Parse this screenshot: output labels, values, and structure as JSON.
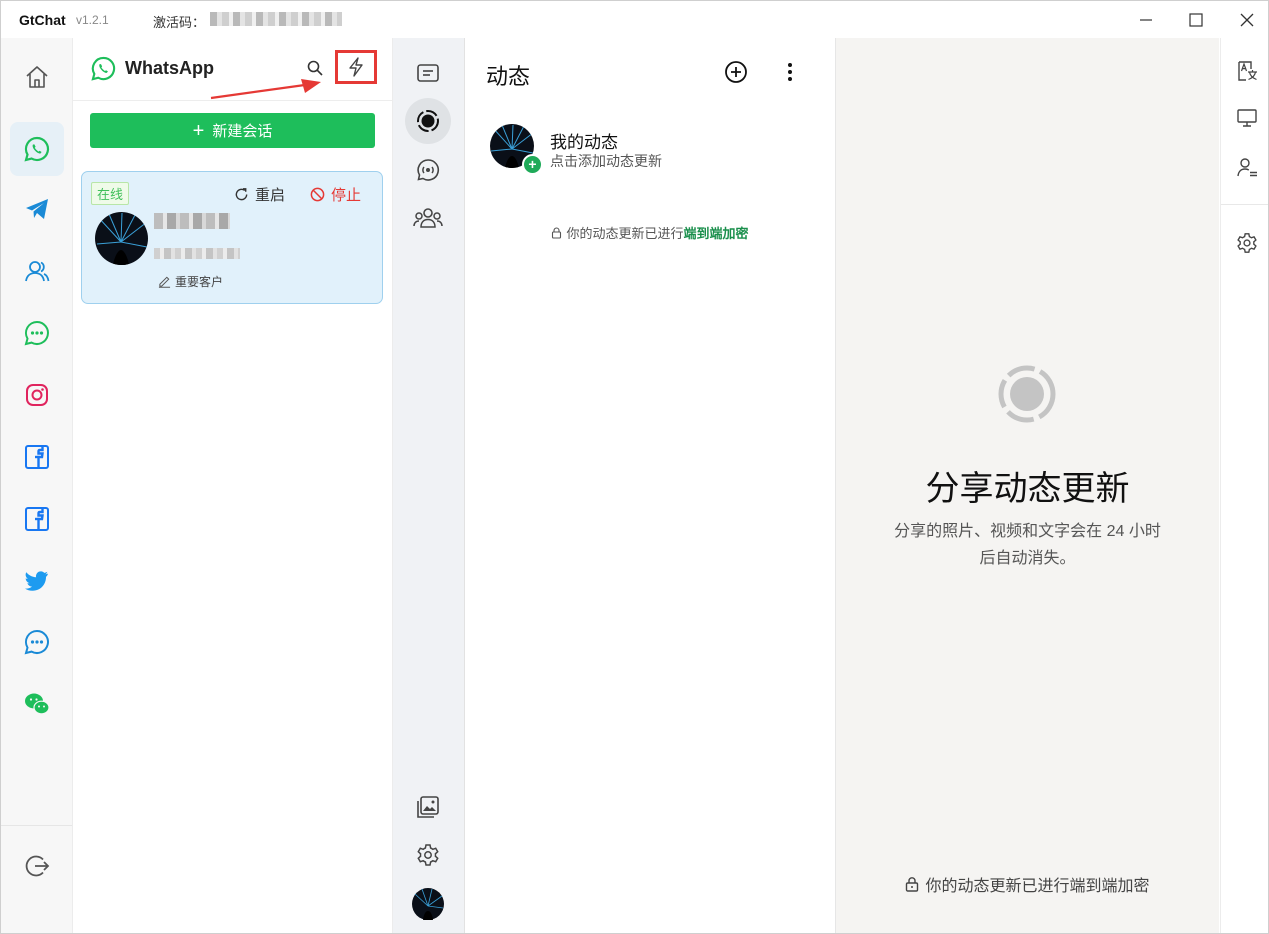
{
  "window": {
    "app_name": "GtChat",
    "version": "v1.2.1",
    "activation_label": "激活码："
  },
  "rail": {
    "items": [
      {
        "name": "home",
        "icon": "home-icon"
      },
      {
        "name": "whatsapp",
        "icon": "whatsapp-icon",
        "active": true
      },
      {
        "name": "telegram",
        "icon": "telegram-icon"
      },
      {
        "name": "contacts",
        "icon": "contacts-icon"
      },
      {
        "name": "line",
        "icon": "chat-bubble-green-icon"
      },
      {
        "name": "instagram",
        "icon": "instagram-icon"
      },
      {
        "name": "facebook",
        "icon": "facebook-icon"
      },
      {
        "name": "facebook-2",
        "icon": "facebook-icon"
      },
      {
        "name": "twitter",
        "icon": "twitter-icon"
      },
      {
        "name": "messenger",
        "icon": "chat-bubble-blue-icon"
      },
      {
        "name": "wechat",
        "icon": "wechat-icon"
      }
    ],
    "logout_icon": "logout-icon"
  },
  "account_panel": {
    "title": "WhatsApp",
    "new_chat_label": "新建会话",
    "card": {
      "status": "在线",
      "restart_label": "重启",
      "stop_label": "停止",
      "tag": "重要客户"
    }
  },
  "status_panel": {
    "title": "动态",
    "my_status_title": "我的动态",
    "my_status_sub": "点击添加动态更新",
    "encryption_prefix": "你的动态更新已进行",
    "encryption_highlight": "端到端加密"
  },
  "detail": {
    "title": "分享动态更新",
    "subtitle_line1": "分享的照片、视频和文字会在 24 小时",
    "subtitle_line2": "后自动消失。",
    "footer": "你的动态更新已进行端到端加密"
  },
  "colors": {
    "whatsapp_green": "#1ebe5b",
    "highlight_red": "#e53935",
    "card_bg": "#e1f1fb",
    "detail_bg": "#f5f4f2"
  }
}
